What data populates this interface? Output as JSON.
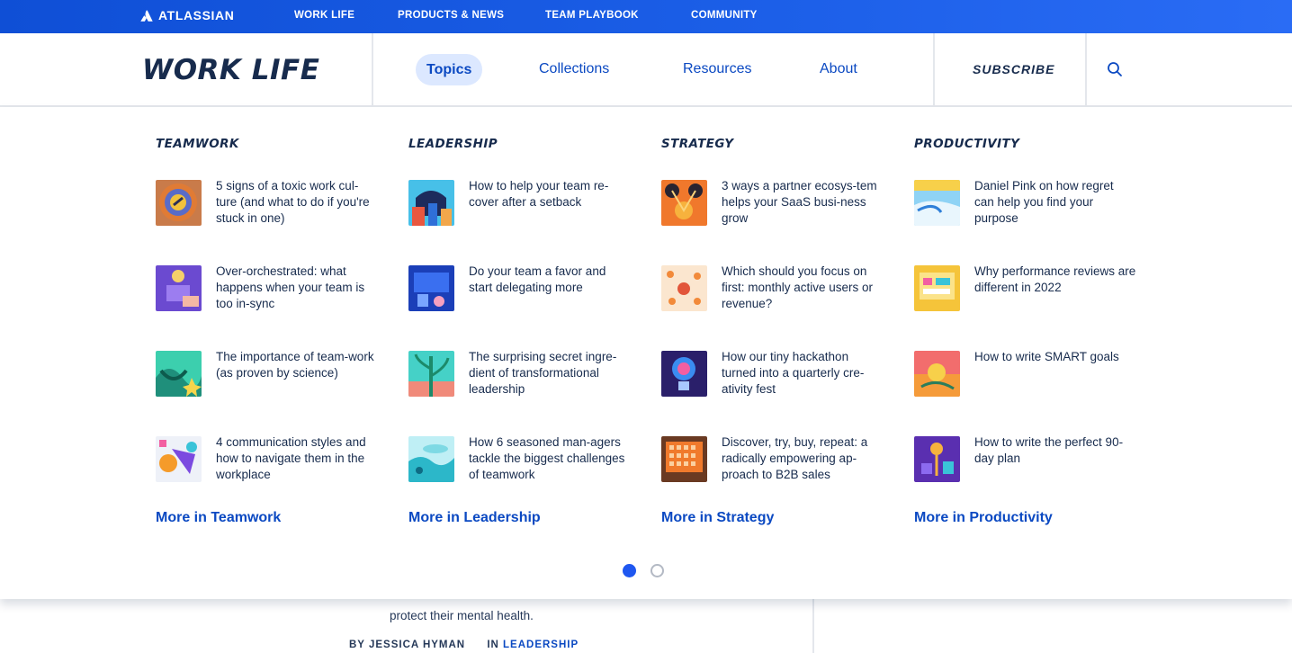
{
  "topbar": {
    "brand": "ATLASSIAN",
    "links": [
      "WORK LIFE",
      "PRODUCTS & NEWS",
      "TEAM PLAYBOOK",
      "COMMUNITY"
    ]
  },
  "header": {
    "logo": "WORK LIFE",
    "nav": [
      "Topics",
      "Collections",
      "Resources",
      "About"
    ],
    "active_nav": "Topics",
    "subscribe": "SUBSCRIBE"
  },
  "menu": {
    "columns": [
      {
        "category": "TEAMWORK",
        "articles": [
          "5 signs of a toxic work cul-ture (and what to do if you're stuck in one)",
          "Over-orchestrated: what happens when your team is too in-sync",
          "The importance of team-work (as proven by science)",
          "4 communication styles and how to navigate them in the workplace"
        ],
        "more": "More in Teamwork"
      },
      {
        "category": "LEADERSHIP",
        "articles": [
          "How to help your team re-cover after a setback",
          "Do your team a favor and start delegating more",
          "The surprising secret ingre-dient of transformational leadership",
          "How 6 seasoned man-agers tackle the biggest challenges of teamwork"
        ],
        "more": "More in Leadership"
      },
      {
        "category": "STRATEGY",
        "articles": [
          "3 ways a partner ecosys-tem helps your SaaS busi-ness grow",
          "Which should you focus on first: monthly active users or revenue?",
          "How our tiny hackathon turned into a quarterly cre-ativity fest",
          "Discover, try, buy, repeat: a radically empowering ap-proach to B2B sales"
        ],
        "more": "More in Strategy"
      },
      {
        "category": "PRODUCTIVITY",
        "articles": [
          "Daniel Pink on how regret can help you find your purpose",
          "Why performance reviews are different in 2022",
          "How to write SMART goals",
          "How to write the perfect 90-day plan"
        ],
        "more": "More in Productivity"
      }
    ],
    "pagination": {
      "current": 1,
      "total": 2
    }
  },
  "article_below": {
    "excerpt": "protect their mental health.",
    "byline": "BY JESSICA HYMAN",
    "in_label": "IN",
    "category": "LEADERSHIP"
  },
  "colors": {
    "topbar": "#1c5fe8",
    "link": "#0b49c2",
    "text": "#172b4d",
    "active_pill": "#dce8ff",
    "dot_active": "#1f57f0"
  }
}
